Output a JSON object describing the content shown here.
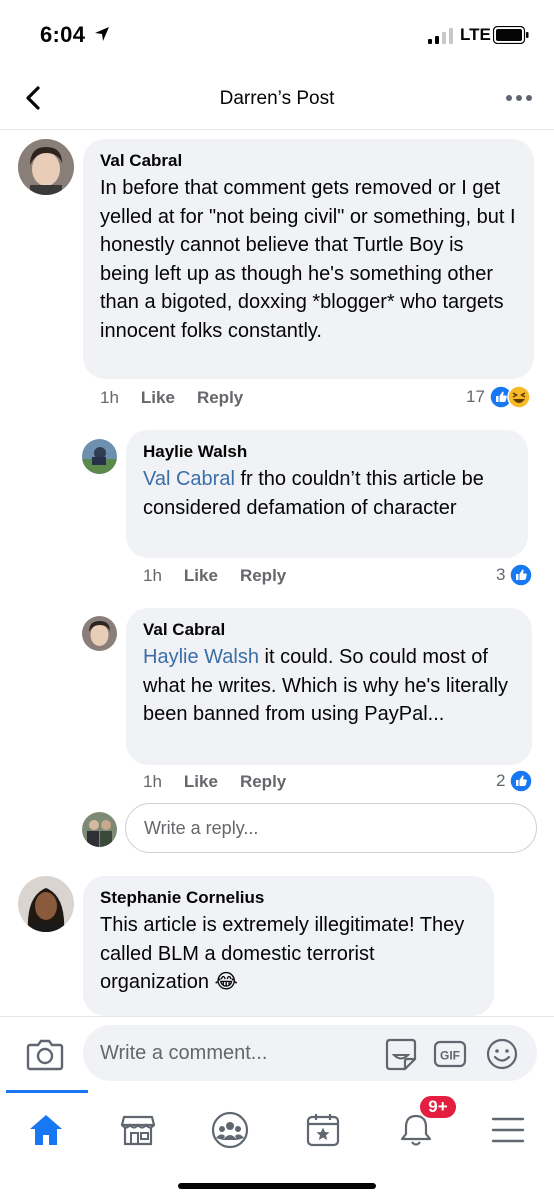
{
  "status_bar": {
    "time": "6:04",
    "network": "LTE"
  },
  "header": {
    "title": "Darren’s Post"
  },
  "comments": [
    {
      "author": "Val Cabral",
      "text": "In before that comment gets removed or I get yelled at for \"not being civil\" or something, but I honestly cannot believe that Turtle Boy is being left up as though he's something other than a bigoted, doxxing *blogger* who targets innocent folks constantly.",
      "time": "1h",
      "like": "Like",
      "reply": "Reply",
      "reaction_count": "17",
      "replies": [
        {
          "author": "Haylie Walsh",
          "mention": "Val Cabral",
          "text": " fr tho couldn’t this article be considered defamation of character",
          "time": "1h",
          "like": "Like",
          "reply": "Reply",
          "reaction_count": "3"
        },
        {
          "author": "Val Cabral",
          "mention": "Haylie Walsh",
          "text": " it could. So could most of what he writes. Which is why he's literally been banned from using PayPal...",
          "time": "1h",
          "like": "Like",
          "reply": "Reply",
          "reaction_count": "2"
        }
      ],
      "reply_placeholder": "Write a reply..."
    },
    {
      "author": "Stephanie Cornelius",
      "text": "This article is extremely illegitimate! They called BLM a domestic terrorist organization 😂"
    }
  ],
  "composer": {
    "placeholder": "Write a comment...",
    "gif_label": "GIF"
  },
  "tabbar": {
    "notification_badge": "9+"
  },
  "colors": {
    "accent": "#1877f2",
    "mention": "#3b6ea8",
    "bubble": "#f0f2f5",
    "badge": "#e41e3f"
  }
}
